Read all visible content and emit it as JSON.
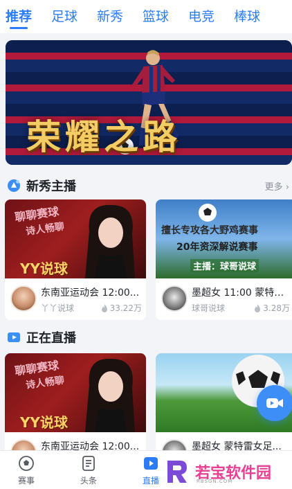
{
  "tabs": [
    {
      "label": "推荐",
      "active": true
    },
    {
      "label": "足球"
    },
    {
      "label": "新秀"
    },
    {
      "label": "篮球"
    },
    {
      "label": "电竞"
    },
    {
      "label": "棒球"
    }
  ],
  "banner": {
    "title": "荣耀之路",
    "slides_total": 8,
    "active_slide": 1
  },
  "sections": {
    "rookies": {
      "title": "新秀主播",
      "more": "更多 ›"
    },
    "live": {
      "title": "正在直播"
    }
  },
  "rookie_cards": [
    {
      "thumb_text_1": "聊聊赛球",
      "thumb_text_2": "诗人畅聊",
      "thumb_logo": "YY说球",
      "title": "东南亚运动会 12:00...",
      "streamer": "丫丫说球",
      "views": "33.22万"
    },
    {
      "thumb_text_1": "擅长专攻各大野鸡赛事",
      "thumb_text_2": "20年资深解说赛事",
      "thumb_text_3": "主播：球哥说球",
      "title": "墨超女 11:00 蒙特雷...",
      "streamer": "球哥说球",
      "views": "3.28万"
    }
  ],
  "live_cards": [
    {
      "thumb_text_1": "聊聊赛球",
      "thumb_text_2": "诗人畅聊",
      "thumb_logo": "YY说球",
      "title": "东南亚运动会 12:00..."
    },
    {
      "title": "墨超女  蒙特雷女足..."
    }
  ],
  "bottom_nav": [
    {
      "label": "赛事",
      "icon": "soccer-ball-icon"
    },
    {
      "label": "头条",
      "icon": "document-icon"
    },
    {
      "label": "直播",
      "icon": "play-video-icon",
      "active": true
    }
  ],
  "watermark": {
    "text": "若宝软件园",
    "sub": "RBSGN.COM"
  },
  "colors": {
    "accent": "#2b7cf6",
    "brand_pink": "#e64093"
  }
}
